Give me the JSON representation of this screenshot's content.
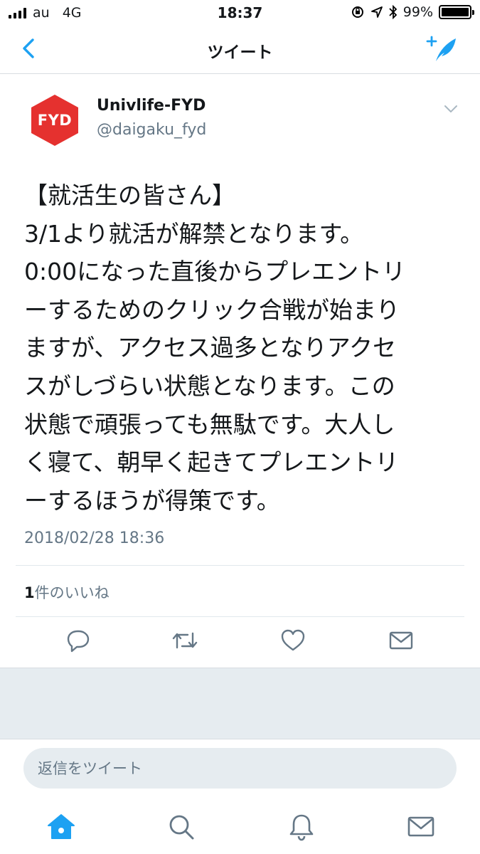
{
  "status": {
    "carrier": "au",
    "network": "4G",
    "time": "18:37",
    "battery": "99%",
    "battery_level": 0.99
  },
  "nav": {
    "title": "ツイート",
    "back_icon": "chevron-left-icon",
    "compose_icon": "compose-tweet-icon"
  },
  "tweet": {
    "avatar_text": "FYD",
    "display_name": "Univlife-FYD",
    "handle": "@daigaku_fyd",
    "text": "【就活生の皆さん】\n3/1より就活が解禁となります。\n0:00になった直後からプレエントリ\nーするためのクリック合戦が始まり\nますが、アクセス過多となりアクセ\nスがしづらい状態となります。この\n状態で頑張っても無駄です。大人し\nく寝て、朝早く起きてプレエントリ\nーするほうが得策です。",
    "timestamp": "2018/02/28 18:36",
    "likes_count": "1",
    "likes_label": "件のいいね"
  },
  "reply": {
    "placeholder": "返信をツイート"
  },
  "colors": {
    "accent": "#1da1f2",
    "avatar_red": "#e5312f",
    "secondary_text": "#657786",
    "icon_gray": "#657786",
    "band_gray": "#e6ecf0"
  },
  "icons": {
    "actions": [
      "reply-icon",
      "retweet-icon",
      "like-icon",
      "direct-message-icon"
    ],
    "tabs": [
      "home-icon",
      "search-icon",
      "notifications-icon",
      "messages-icon"
    ]
  }
}
